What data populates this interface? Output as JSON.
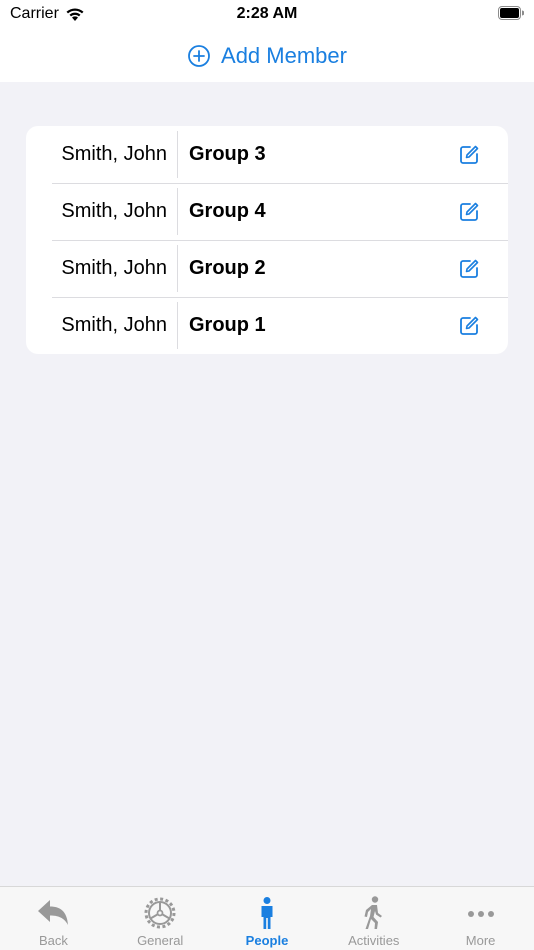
{
  "status_bar": {
    "carrier": "Carrier",
    "time": "2:28 AM"
  },
  "header": {
    "add_member_label": "Add Member"
  },
  "members": [
    {
      "name": "Smith, John",
      "group": "Group 3"
    },
    {
      "name": "Smith, John",
      "group": "Group 4"
    },
    {
      "name": "Smith, John",
      "group": "Group 2"
    },
    {
      "name": "Smith, John",
      "group": "Group 1"
    }
  ],
  "tab_bar": {
    "tabs": [
      {
        "label": "Back",
        "icon": "back-arrow-icon"
      },
      {
        "label": "General",
        "icon": "gear-icon"
      },
      {
        "label": "People",
        "icon": "person-icon",
        "active": true
      },
      {
        "label": "Activities",
        "icon": "walking-icon"
      },
      {
        "label": "More",
        "icon": "more-dots-icon"
      }
    ]
  },
  "colors": {
    "accent": "#1a7fe0",
    "inactive": "#999999",
    "background": "#f2f2f7"
  }
}
